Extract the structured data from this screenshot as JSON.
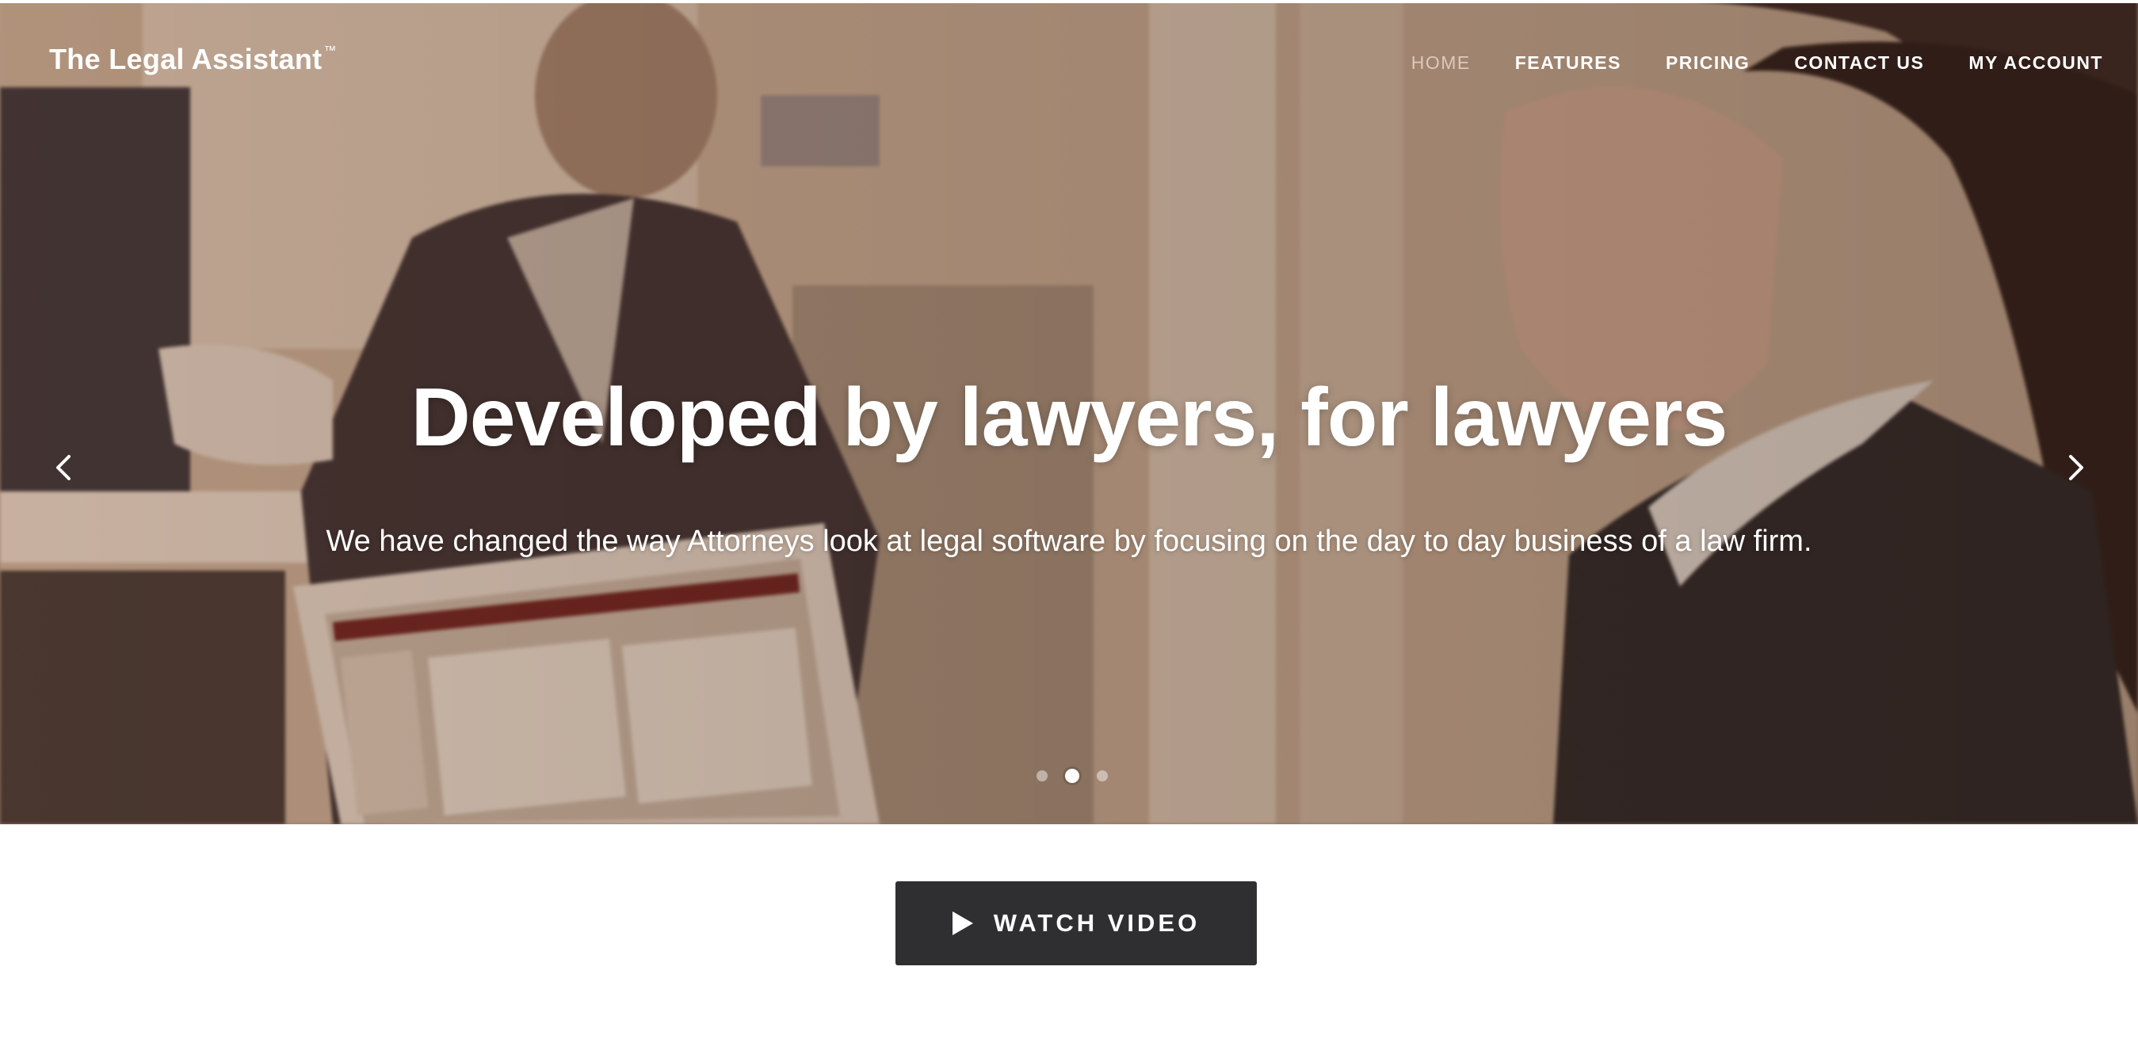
{
  "brand": {
    "name": "The Legal Assistant",
    "trademark": "™"
  },
  "nav": {
    "items": [
      {
        "label": "HOME",
        "active": true
      },
      {
        "label": "FEATURES",
        "active": false
      },
      {
        "label": "PRICING",
        "active": false
      },
      {
        "label": "CONTACT US",
        "active": false
      },
      {
        "label": "MY ACCOUNT",
        "active": false
      }
    ]
  },
  "hero": {
    "headline": "Developed by lawyers, for lawyers",
    "subheadline": "We have changed the way Attorneys look at legal software by focusing on the day to day business of a law firm.",
    "prev_icon": "chevron-left-icon",
    "next_icon": "chevron-right-icon",
    "slides": {
      "count": 3,
      "active_index": 1
    }
  },
  "cta": {
    "label": "WATCH VIDEO",
    "icon": "play-icon"
  },
  "colors": {
    "button_bg": "#2f2f31",
    "text_light": "#ffffff",
    "nav_active": "#dcc9bb",
    "hero_tone": "#b89a84"
  }
}
